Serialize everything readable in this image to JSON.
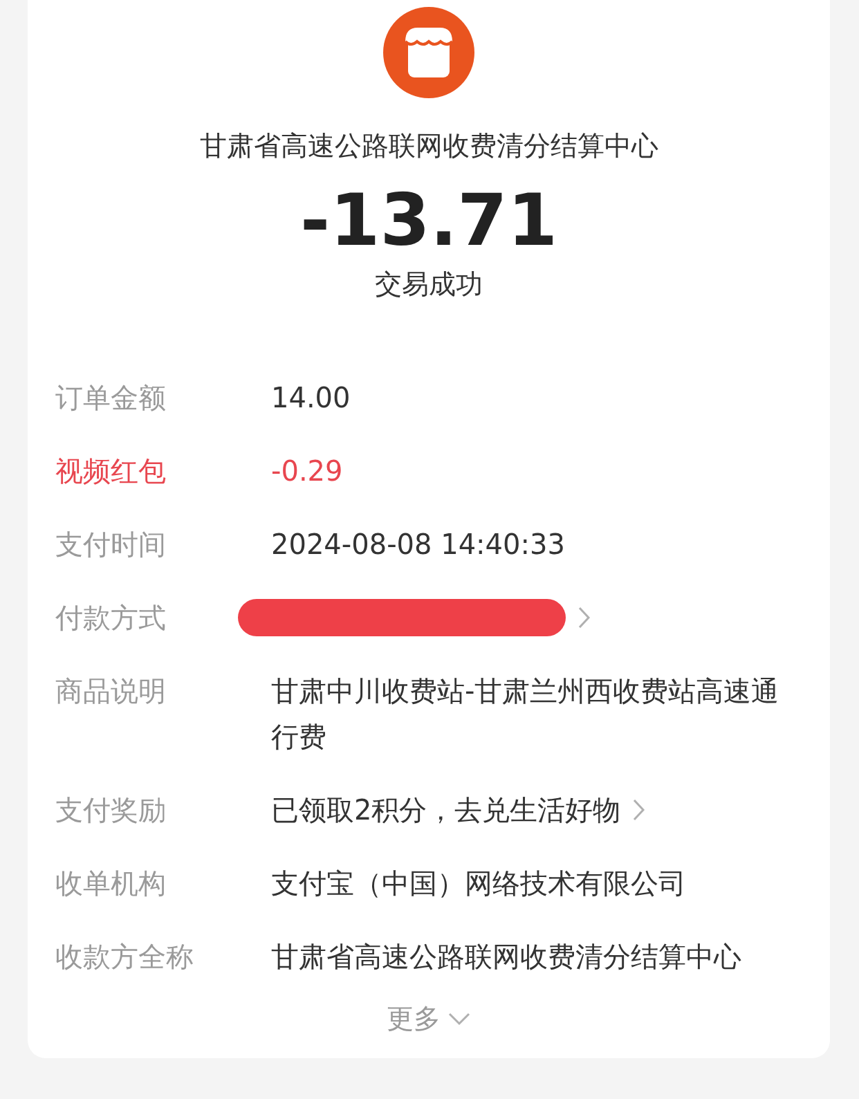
{
  "header": {
    "title": "甘肃省高速公路联网收费清分结算中心",
    "amount": "-13.71",
    "status": "交易成功"
  },
  "rows": [
    {
      "label": "订单金额",
      "value": "14.00",
      "kind": "text"
    },
    {
      "label": "视频红包",
      "value": "-0.29",
      "kind": "highlight"
    },
    {
      "label": "支付时间",
      "value": "2024-08-08 14:40:33",
      "kind": "text"
    },
    {
      "label": "付款方式",
      "kind": "redacted"
    },
    {
      "label": "商品说明",
      "value": "甘肃中川收费站-甘肃兰州西收费站高速通行费",
      "kind": "text"
    },
    {
      "label": "支付奖励",
      "value": "已领取2积分，去兑生活好物",
      "kind": "link"
    },
    {
      "label": "收单机构",
      "value": "支付宝（中国）网络技术有限公司",
      "kind": "text"
    },
    {
      "label": "收款方全称",
      "value": "甘肃省高速公路联网收费清分结算中心",
      "kind": "text"
    }
  ],
  "more": "更多"
}
